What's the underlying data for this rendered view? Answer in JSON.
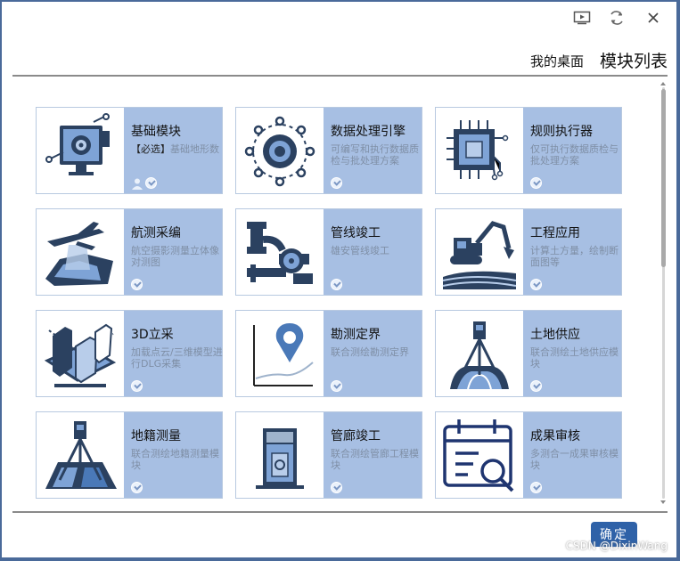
{
  "window": {
    "controls": [
      {
        "name": "play-icon"
      },
      {
        "name": "refresh-icon"
      },
      {
        "name": "close-icon"
      }
    ]
  },
  "tabs": [
    {
      "label": "我的桌面"
    },
    {
      "label": "模块列表"
    }
  ],
  "modules": [
    {
      "name": "基础模块",
      "required_tag": "【必选】",
      "desc": "基础地形数",
      "icon": "computer-gear-icon",
      "has_user_icon": true
    },
    {
      "name": "数据处理引擎",
      "desc": "可编写和执行数据质检与批处理方案",
      "icon": "gear-network-icon"
    },
    {
      "name": "规则执行器",
      "desc": "仅可执行数据质检与批处理方案",
      "icon": "chip-icon"
    },
    {
      "name": "航测采编",
      "desc": "航空摄影测量立体像对测图",
      "icon": "drone-terrain-icon"
    },
    {
      "name": "管线竣工",
      "desc": "雄安管线竣工",
      "icon": "pipeline-valve-icon"
    },
    {
      "name": "工程应用",
      "desc": "计算土方量，绘制断面图等",
      "icon": "excavator-icon"
    },
    {
      "name": "3D立采",
      "desc": "加载点云/三维模型进行DLG采集",
      "icon": "3d-buildings-icon"
    },
    {
      "name": "勘测定界",
      "desc": "联合测绘勘测定界",
      "icon": "location-pin-icon"
    },
    {
      "name": "土地供应",
      "desc": "联合测绘土地供应模块",
      "icon": "total-station-road-icon"
    },
    {
      "name": "地籍测量",
      "desc": "联合测绘地籍测量模块",
      "icon": "total-station-parcel-icon"
    },
    {
      "name": "管廊竣工",
      "desc": "联合测绘管廊工程模块",
      "icon": "utility-tunnel-icon"
    },
    {
      "name": "成果审核",
      "desc": "多测合一成果审核模块",
      "icon": "calendar-search-icon"
    }
  ],
  "confirm_label": "确定",
  "watermark": "CSDN @DixinWang",
  "colors": {
    "panel": "#a7bfe3",
    "accent": "#2f62a8",
    "icon_dark": "#2b4160"
  }
}
